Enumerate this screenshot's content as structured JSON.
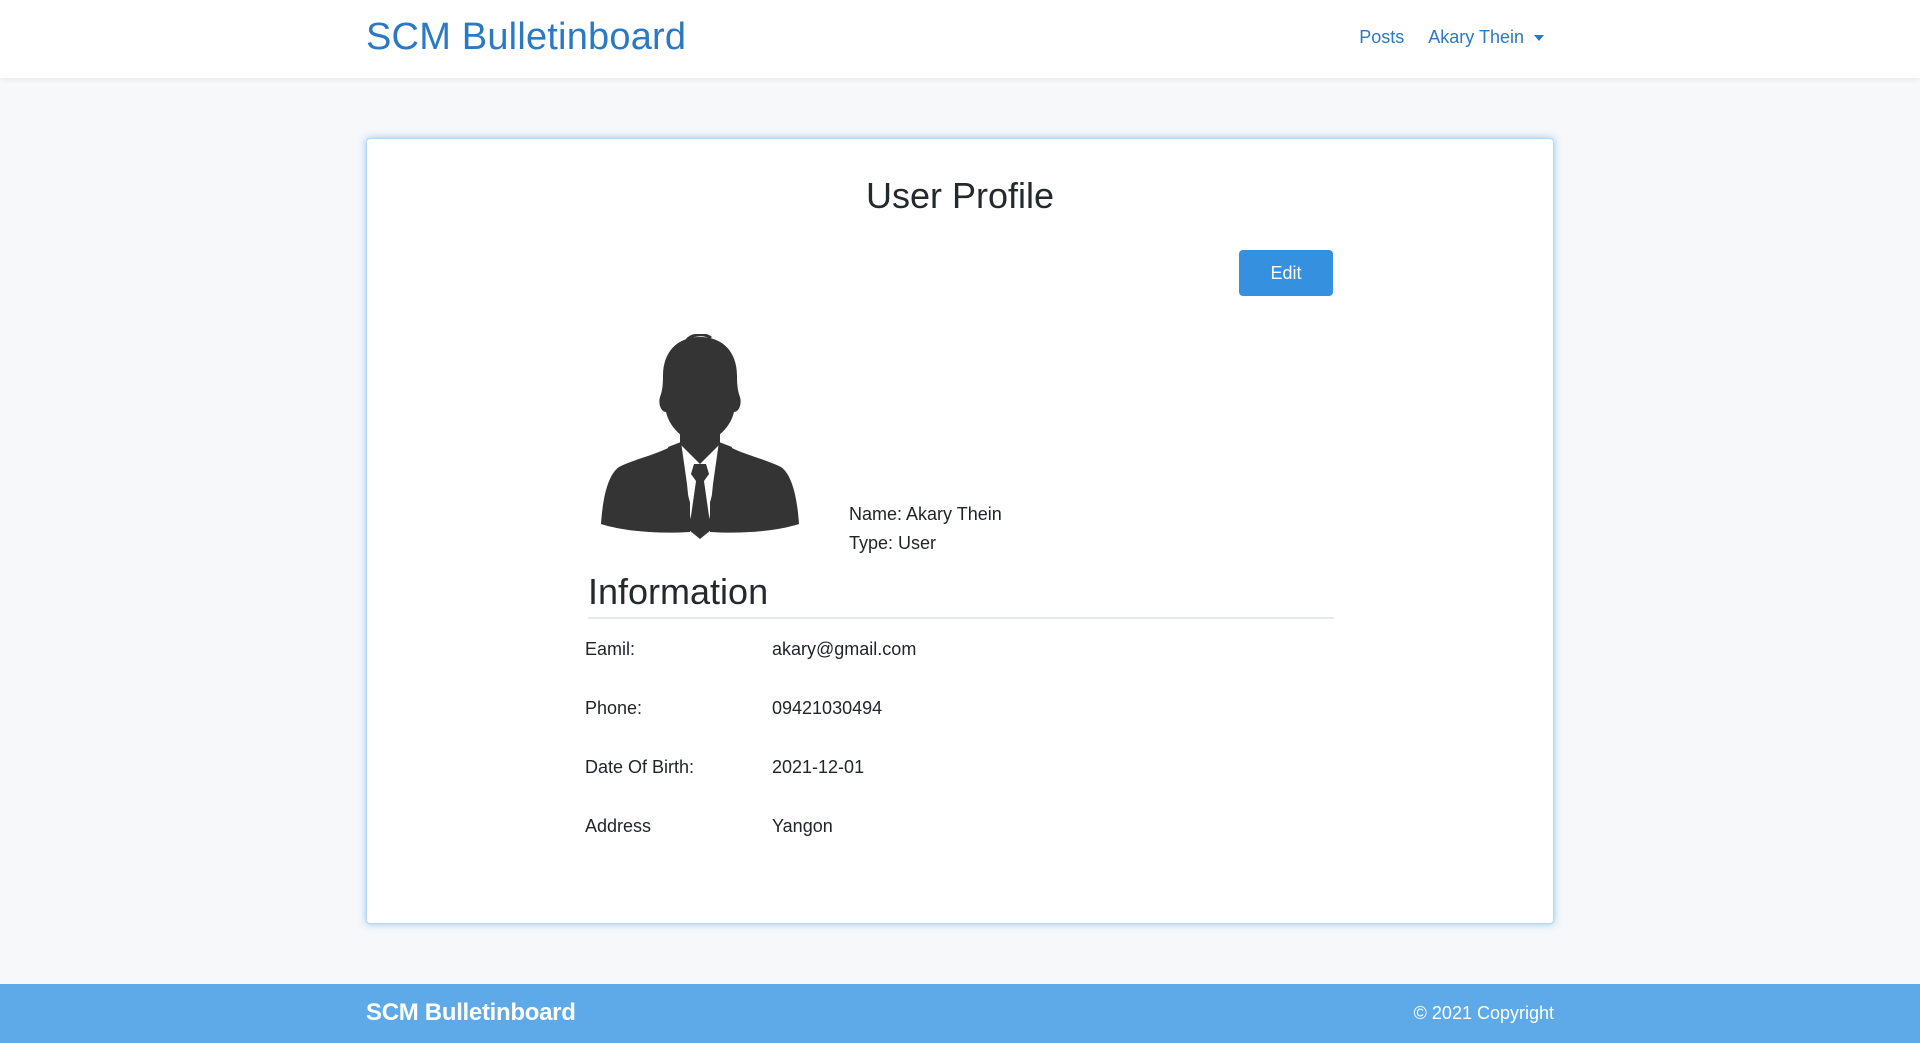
{
  "navbar": {
    "brand": "SCM Bulletinboard",
    "posts_link": "Posts",
    "user_menu": "Akary Thein"
  },
  "profile": {
    "title": "User Profile",
    "edit_label": "Edit",
    "name_line": "Name: Akary Thein",
    "type_line": "Type: User",
    "avatar_icon": "user-silhouette-icon"
  },
  "information": {
    "heading": "Information",
    "rows": [
      {
        "label": "Eamil:",
        "value": "akary@gmail.com"
      },
      {
        "label": "Phone:",
        "value": "09421030494"
      },
      {
        "label": "Date Of Birth:",
        "value": "2021-12-01"
      },
      {
        "label": "Address",
        "value": "Yangon"
      }
    ]
  },
  "footer": {
    "brand": "SCM Bulletinboard",
    "copyright": "© 2021 Copyright"
  },
  "colors": {
    "brand_blue": "#2b79c2",
    "button_blue": "#3591e0",
    "footer_blue": "#5ea9e7"
  }
}
